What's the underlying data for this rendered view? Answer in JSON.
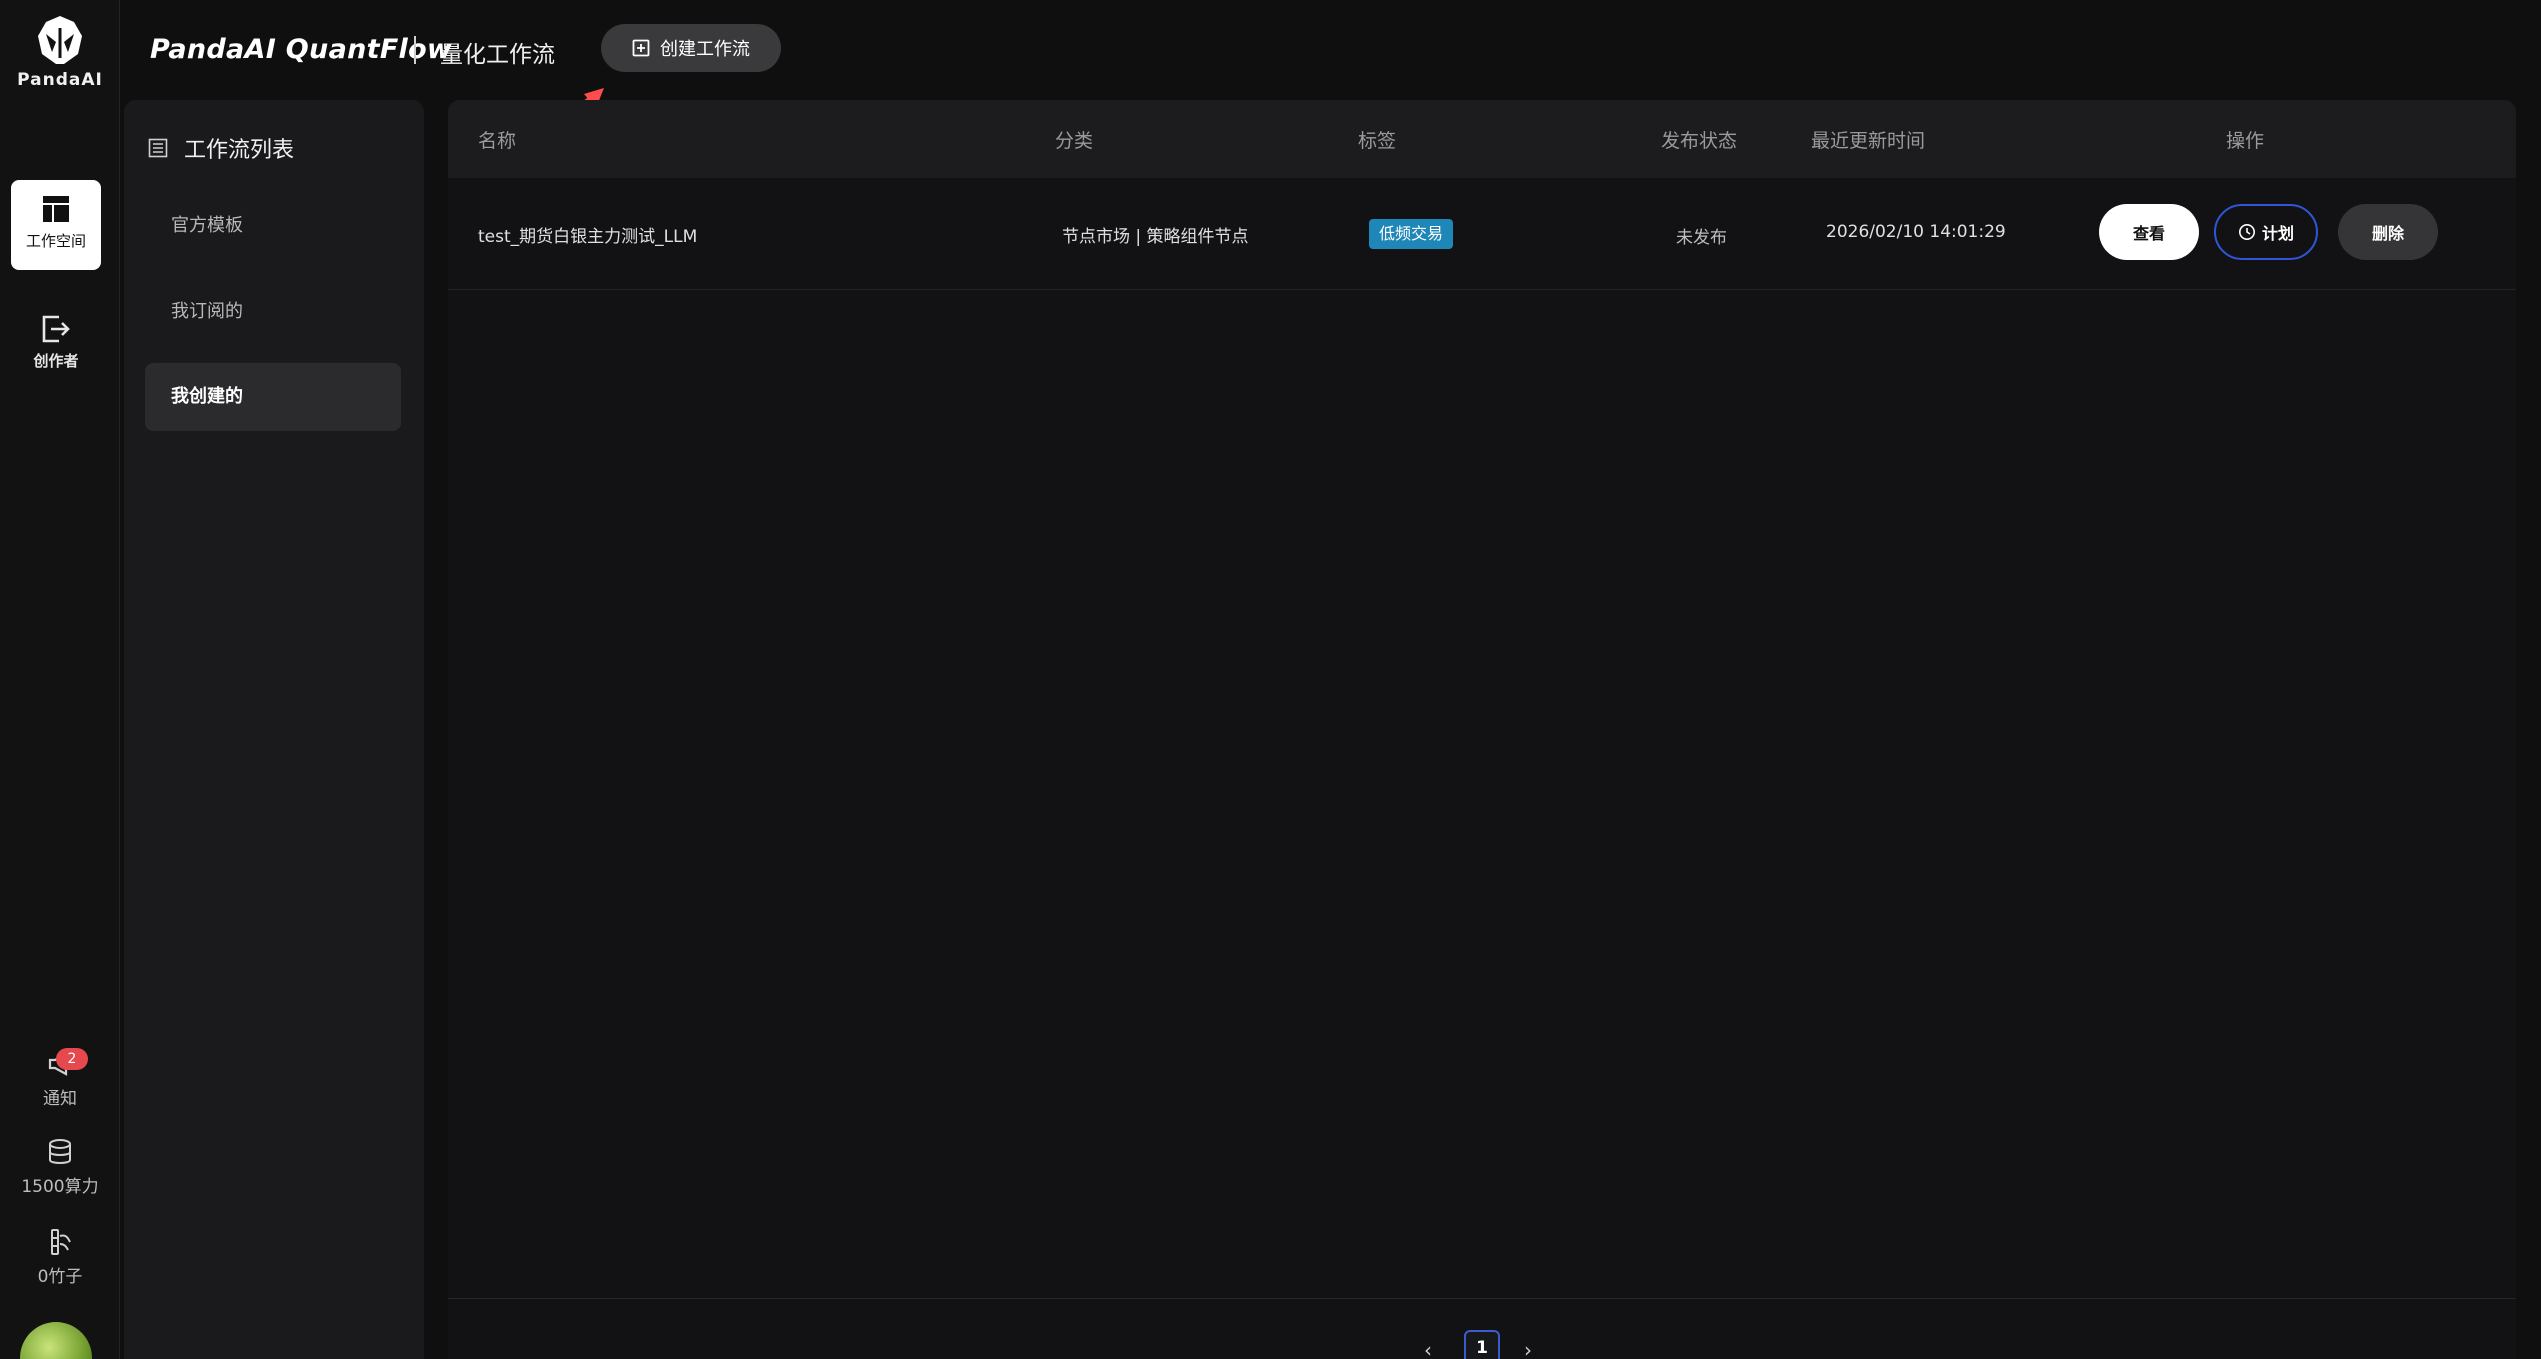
{
  "rail": {
    "logo_text": "PandaAI",
    "items": [
      {
        "label": "工作空间",
        "icon": "layout-icon"
      },
      {
        "label": "创作者",
        "icon": "exit-box-icon"
      }
    ],
    "bottom": [
      {
        "label": "通知",
        "icon": "megaphone-icon",
        "badge": "2"
      },
      {
        "label": "1500算力",
        "icon": "database-icon"
      },
      {
        "label": "0竹子",
        "icon": "bamboo-icon"
      }
    ]
  },
  "header": {
    "brand": "PandaAI QuantFlow",
    "subtitle": "量化工作流",
    "create_button": "创建工作流"
  },
  "sidebar": {
    "title": "工作流列表",
    "items": [
      {
        "label": "官方模板"
      },
      {
        "label": "我订阅的"
      },
      {
        "label": "我创建的"
      }
    ]
  },
  "table": {
    "columns": [
      "名称",
      "分类",
      "标签",
      "发布状态",
      "最近更新时间",
      "操作"
    ],
    "rows": [
      {
        "name": "test_期货白银主力测试_LLM",
        "category": "节点市场 | 策略组件节点",
        "tag": "低频交易",
        "status": "未发布",
        "updated": "2026/02/10 14:01:29",
        "actions": {
          "view": "查看",
          "plan": "计划",
          "delete": "删除"
        }
      }
    ]
  },
  "pagination": {
    "current": "1",
    "prev": "‹",
    "next": "›"
  },
  "colors": {
    "background": "#0f0f10",
    "tag_blue": "#1f86b8",
    "plan_border": "#2f56d8",
    "badge_red": "#e5484d",
    "annotation_arrow": "#ff4d4f"
  }
}
